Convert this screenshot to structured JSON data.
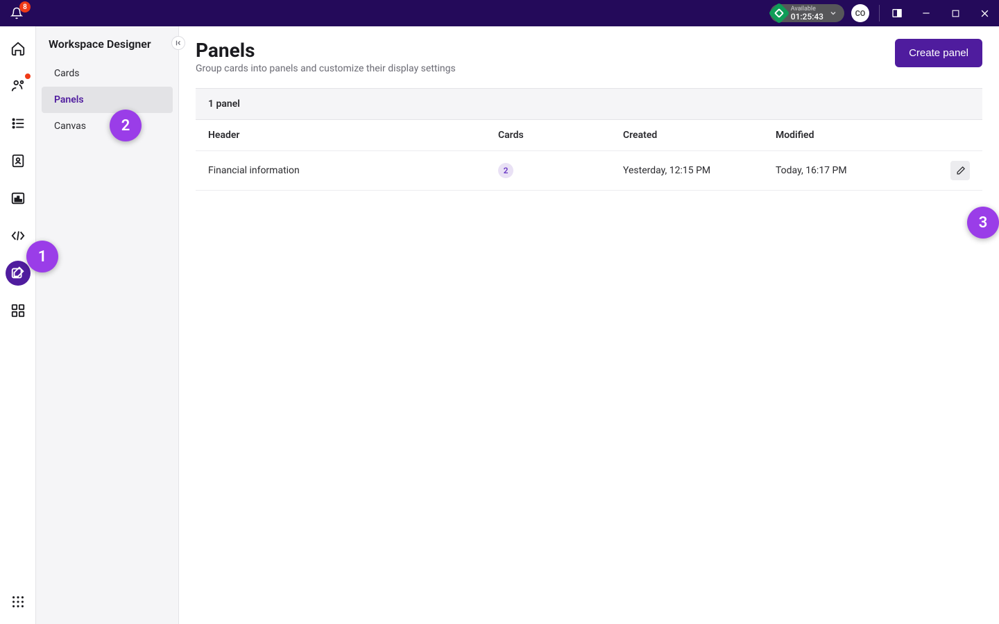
{
  "titlebar": {
    "notification_count": "8",
    "status_label": "Available",
    "status_time": "01:25:43",
    "avatar_initials": "CO"
  },
  "rail": {
    "items": [
      {
        "name": "home",
        "has_dot": false
      },
      {
        "name": "routing",
        "has_dot": true
      },
      {
        "name": "queues",
        "has_dot": false
      },
      {
        "name": "contacts",
        "has_dot": false
      },
      {
        "name": "reports",
        "has_dot": false
      },
      {
        "name": "code",
        "has_dot": false
      },
      {
        "name": "designer",
        "has_dot": false,
        "active": true
      },
      {
        "name": "apps",
        "has_dot": false
      }
    ]
  },
  "sidebar": {
    "title": "Workspace Designer",
    "items": [
      {
        "label": "Cards"
      },
      {
        "label": "Panels",
        "active": true
      },
      {
        "label": "Canvas"
      }
    ]
  },
  "page": {
    "title": "Panels",
    "subtitle": "Group cards into panels and customize their display settings",
    "create_label": "Create panel"
  },
  "table": {
    "caption": "1 panel",
    "columns": {
      "header": "Header",
      "cards": "Cards",
      "created": "Created",
      "modified": "Modified"
    },
    "rows": [
      {
        "header": "Financial information",
        "cards": "2",
        "created": "Yesterday, 12:15 PM",
        "modified": "Today, 16:17 PM"
      }
    ]
  },
  "callouts": {
    "c1": "1",
    "c2": "2",
    "c3": "3"
  }
}
